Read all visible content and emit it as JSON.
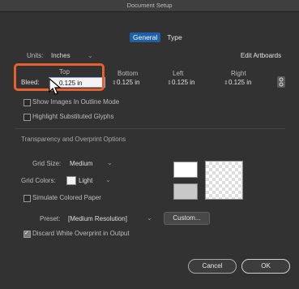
{
  "window": {
    "title": "Document Setup"
  },
  "tabs": [
    {
      "label": "General"
    },
    {
      "label": "Type"
    }
  ],
  "units": {
    "label": "Units:",
    "value": "Inches"
  },
  "edit_artboards": "Edit Artboards",
  "bleed": {
    "label": "Bleed:",
    "headers": {
      "top": "Top",
      "bottom": "Bottom",
      "left": "Left",
      "right": "Right"
    },
    "top": "0.125 in",
    "bottom": "0.125 in",
    "left": "0.125 in",
    "right": "0.125 in"
  },
  "options": {
    "outline_mode": "Show Images In Outline Mode",
    "highlight_glyphs": "Highlight Substituted Glyphs"
  },
  "transparency": {
    "section_title": "Transparency and Overprint Options",
    "grid_size_label": "Grid Size:",
    "grid_size_value": "Medium",
    "grid_colors_label": "Grid Colors:",
    "grid_colors_value": "Light",
    "simulate_paper": "Simulate Colored Paper",
    "preset_label": "Preset:",
    "preset_value": "[Medium Resolution]",
    "custom_button": "Custom...",
    "discard_white": "Discard White Overprint in Output",
    "discard_white_checked": true
  },
  "buttons": {
    "cancel": "Cancel",
    "ok": "OK"
  },
  "icons": {
    "chain": "link-icon",
    "cursor": "mouse-pointer-icon"
  }
}
